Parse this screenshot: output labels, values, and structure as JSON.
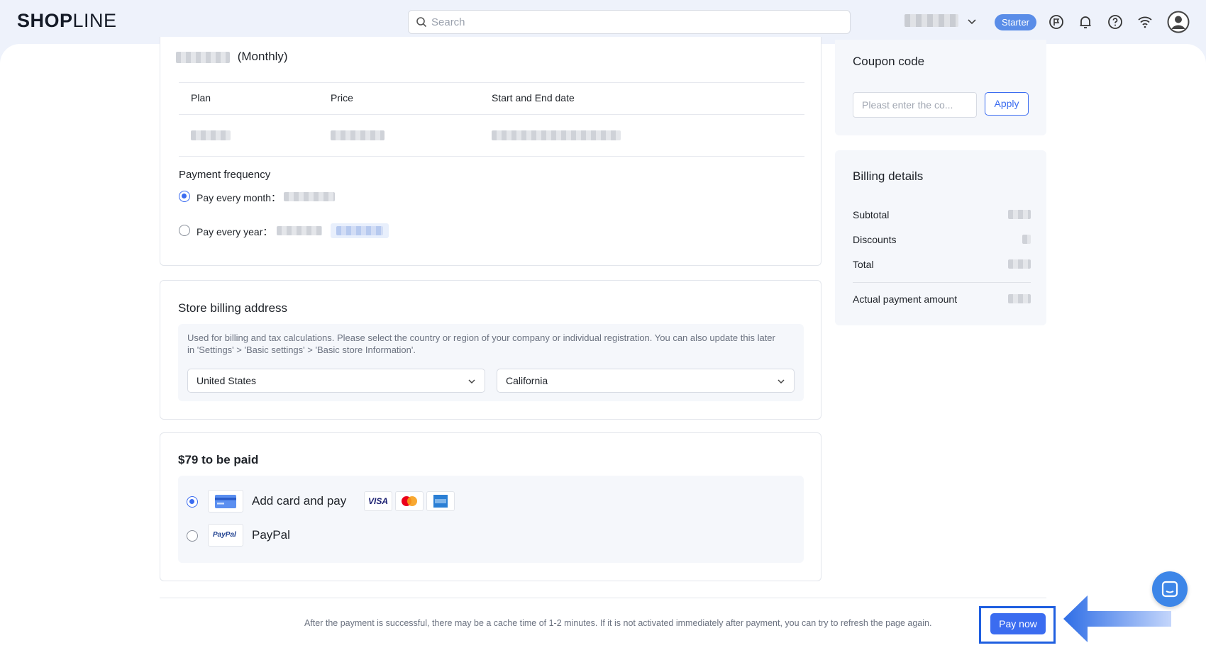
{
  "header": {
    "logo_bold": "SHOP",
    "logo_light": "LINE",
    "search_placeholder": "Search",
    "plan_badge": "Starter",
    "icons": [
      "flag-icon",
      "bell-icon",
      "help-icon",
      "wifi-icon",
      "user-avatar-icon"
    ]
  },
  "plan_card": {
    "plan_suffix": "(Monthly)",
    "columns": [
      "Plan",
      "Price",
      "Start and End date"
    ],
    "frequency_title": "Payment frequency",
    "options": [
      {
        "label": "Pay every month：",
        "selected": true
      },
      {
        "label": "Pay every year：",
        "selected": false
      }
    ]
  },
  "address_card": {
    "title": "Store billing address",
    "help": "Used for billing and tax calculations. Please select the country or region of your company or individual registration. You can also update this later in 'Settings' > 'Basic settings' > 'Basic store Information'.",
    "country": "United States",
    "state": "California"
  },
  "payment_card": {
    "title": "$79 to be paid",
    "methods": [
      {
        "label": "Add card and pay",
        "selected": true
      },
      {
        "label": "PayPal",
        "selected": false
      }
    ],
    "brand_visa": "VISA",
    "brand_paypal": "PayPal"
  },
  "coupon": {
    "title": "Coupon code",
    "placeholder": "Pleast enter the co...",
    "apply_label": "Apply"
  },
  "billing": {
    "title": "Billing details",
    "rows": [
      "Subtotal",
      "Discounts",
      "Total"
    ],
    "actual_label": "Actual payment amount"
  },
  "footer": {
    "note": "After the payment is successful, there may be a cache time of 1-2 minutes. If it is not activated immediately after payment, you can try to refresh the page again.",
    "pay_label": "Pay now"
  },
  "colors": {
    "accent": "#3b6cf0",
    "highlight": "#1f5fe0"
  }
}
